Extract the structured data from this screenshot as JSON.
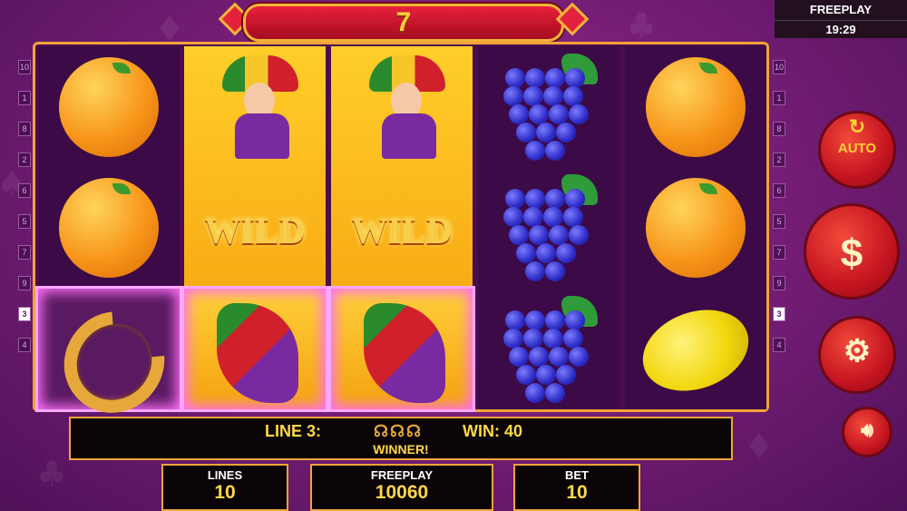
{
  "banner": {
    "value": "7"
  },
  "freeplay_box": {
    "label": "FREEPLAY",
    "time": "19:29"
  },
  "reels": {
    "wild_label": "WILD",
    "reel1": [
      "orange",
      "orange",
      "horseshoe"
    ],
    "reel2": [
      "wild-jester",
      "wild-jester",
      "wild-jester"
    ],
    "reel3": [
      "wild-jester",
      "wild-jester",
      "wild-jester"
    ],
    "reel4": [
      "grapes",
      "grapes",
      "grapes"
    ],
    "reel5": [
      "orange",
      "orange",
      "lemon"
    ]
  },
  "line_numbers": {
    "left": [
      "10",
      "1",
      "8",
      "2",
      "6",
      "5",
      "7",
      "9",
      "3",
      "4"
    ],
    "right": [
      "10",
      "1",
      "8",
      "2",
      "6",
      "5",
      "7",
      "9",
      "3",
      "4"
    ],
    "active": "3"
  },
  "info": {
    "line_label": "LINE 3:",
    "symbols": "☊☊☊",
    "win_label": "WIN: 40",
    "winner": "WINNER!"
  },
  "stats": {
    "lines_label": "LINES",
    "lines_value": "10",
    "freeplay_label": "FREEPLAY",
    "freeplay_value": "10060",
    "bet_label": "BET",
    "bet_value": "10"
  },
  "buttons": {
    "auto_label": "AUTO"
  },
  "colors": {
    "accent": "#f2a33a",
    "gold_text": "#ffd84a",
    "button_red": "#c41420",
    "win_glow": "#ff6ef5"
  }
}
